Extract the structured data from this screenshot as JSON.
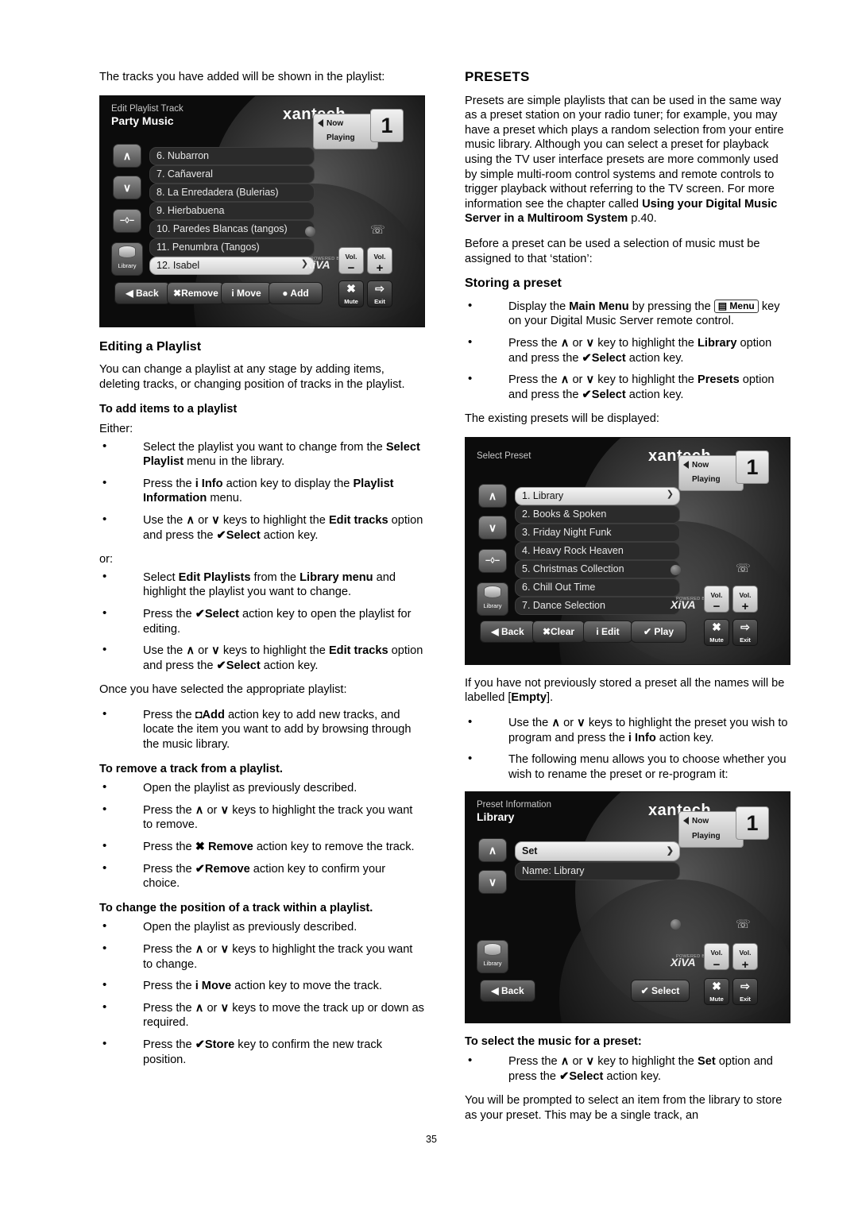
{
  "page_number": "35",
  "left_column": {
    "intro": "The tracks you have added will be shown in the playlist:",
    "screenshot1": {
      "title_small": "Edit Playlist Track",
      "title_big": "Party Music",
      "brand": "xantech",
      "now_playing": "Now Playing",
      "zone_number": "1",
      "library_label": "Library",
      "xiva": "XiVA",
      "powered": "POWERED BY",
      "tracks": [
        "6. Nubarron",
        "7. Cañaveral",
        "8. La Enredadera (Bulerias)",
        "9. Hierbabuena",
        "10. Paredes Blancas (tangos)",
        "11. Penumbra (Tangos)",
        "12. Isabel"
      ],
      "selected_track_index": 6,
      "action_keys": [
        "Back",
        "Remove",
        "Move",
        "Add"
      ],
      "vol_label": "Vol.",
      "mute_label": "Mute",
      "exit_label": "Exit"
    },
    "heading_editing": "Editing a Playlist",
    "para_editing": "You can change a playlist at any stage by adding items, deleting tracks, or changing position of tracks in the playlist.",
    "sub_add_items": "To add items to a playlist",
    "either": "Either:",
    "bullets_add_1": [
      "Select the playlist you want to change from the <b>Select Playlist</b> menu in the library.",
      "Press the <b>i Info</b> action key to display the <b>Playlist Information</b> menu.",
      "Use the <span class=\"glyph\">∧</span> or <span class=\"glyph\">∨</span> keys to highlight the <b>Edit tracks</b> option and press the <b>✔Select</b> action key."
    ],
    "or": "or:",
    "bullets_add_2": [
      "Select <b>Edit Playlists</b> from the <b>Library menu</b> and highlight the playlist you want to change.",
      "Press the <b>✔Select</b> action key to open the playlist for editing.",
      "Use the <span class=\"glyph\">∧</span> or <span class=\"glyph\">∨</span> keys to highlight the <b>Edit tracks</b> option and press the <b>✔Select</b> action key."
    ],
    "once_selected": "Once you have selected the appropriate playlist:",
    "bullets_add_3": [
      "Press the <b>◘Add</b> action key to add new tracks, and locate the item you want to add by browsing through the music library."
    ],
    "sub_remove": "To remove a track from a playlist.",
    "bullets_remove": [
      "Open the playlist as previously described.",
      "Press the <span class=\"glyph\">∧</span> or <span class=\"glyph\">∨</span> keys to highlight the track you want to remove.",
      "Press the <b>✖ Remove</b> action key to remove the track.",
      "Press the <b>✔Remove</b> action key to confirm your choice."
    ],
    "sub_change_position": "To change the position of a track within a playlist.",
    "bullets_position": [
      "Open the playlist as previously described.",
      "Press the <span class=\"glyph\">∧</span> or <span class=\"glyph\">∨</span> keys to highlight the track you want to change.",
      "Press the <b>i Move</b> action key to move the track.",
      "Press the <span class=\"glyph\">∧</span> or <span class=\"glyph\">∨</span> keys to move the track up or down as required.",
      "Press the <b>✔Store</b> key to confirm the new track position."
    ]
  },
  "right_column": {
    "heading_presets": "PRESETS",
    "para_presets_1": "Presets are simple playlists that can be used in the same way as a preset station on your radio tuner; for example, you may have a preset which plays a random selection from your entire music library.  Although you can select a preset for playback using the TV user interface presets are more commonly used by simple multi-room control systems and remote controls to trigger playback without referring to the TV screen.  For more information see the chapter called <b>Using your Digital Music Server in a Multiroom System</b> p.40.",
    "para_presets_2": "Before a preset can be used a selection of music must be assigned to that ‘station’:",
    "heading_storing": "Storing a preset",
    "bullets_storing": [
      "Display the <b>Main Menu</b> by pressing the <span class=\"kbd\">▤ Menu</span> key on your Digital Music Server remote control.",
      "Press the <span class=\"glyph\">∧</span> or <span class=\"glyph\">∨</span> key to highlight the <b>Library</b> option and press the <b>✔Select</b> action key.",
      "Press the <span class=\"glyph\">∧</span> or <span class=\"glyph\">∨</span> key to highlight the <b>Presets</b> option and press the <b>✔Select</b> action key."
    ],
    "para_existing": "The existing presets will be displayed:",
    "screenshot2": {
      "title_small": "Select Preset",
      "brand": "xantech",
      "now_playing": "Now Playing",
      "zone_number": "1",
      "library_label": "Library",
      "xiva": "XiVA",
      "powered": "POWERED BY",
      "items": [
        "1. Library",
        "2. Books & Spoken",
        "3. Friday Night Funk",
        "4. Heavy Rock Heaven",
        "5. Christmas Collection",
        "6. Chill Out Time",
        "7. Dance Selection"
      ],
      "selected_index": 0,
      "action_keys": [
        "Back",
        "Clear",
        "Edit",
        "Play"
      ],
      "vol_label": "Vol.",
      "mute_label": "Mute",
      "exit_label": "Exit"
    },
    "para_empty": "If you have not previously stored a preset all the names will be labelled [<b>Empty</b>].",
    "bullets_empty": [
      "Use the <span class=\"glyph\">∧</span> or <span class=\"glyph\">∨</span> keys to highlight the preset you wish to program and press the <b>i Info</b> action key.",
      "The following menu allows you to choose whether you wish to rename the preset or re-program it:"
    ],
    "screenshot3": {
      "title_small": "Preset Information",
      "title_big": "Library",
      "brand": "xantech",
      "now_playing": "Now Playing",
      "zone_number": "1",
      "library_label": "Library",
      "xiva": "XiVA",
      "powered": "POWERED BY",
      "row_set": "Set",
      "row_name": "Name: Library",
      "action_keys": [
        "Back",
        "Select"
      ],
      "vol_label": "Vol.",
      "mute_label": "Mute",
      "exit_label": "Exit"
    },
    "sub_select_music": "To select the music for a preset:",
    "bullets_select_music": [
      "Press the <span class=\"glyph\">∧</span> or <span class=\"glyph\">∨</span> key to highlight the <b>Set</b> option and press the <b>✔Select</b> action key."
    ],
    "para_prompt": "You will be prompted to select an item from the library to store as your preset.  This may be a single track, an"
  }
}
